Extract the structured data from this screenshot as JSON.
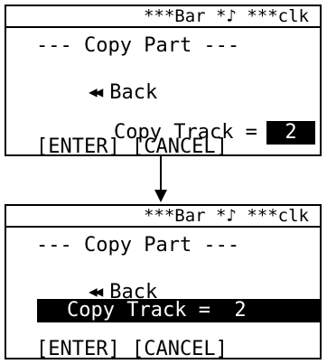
{
  "top_screen": {
    "status": "***Bar *♪ ***clk",
    "title": "--- Copy Part ---",
    "back_label": "Back",
    "copy_label": "Copy Track =",
    "copy_value": "2",
    "keys": "[ENTER] [CANCEL]"
  },
  "bottom_screen": {
    "status": "***Bar *♪ ***clk",
    "title": "--- Copy Part ---",
    "back_label": "Back",
    "copy_row": "Copy Track =  2",
    "keys": "[ENTER] [CANCEL]"
  },
  "icons": {
    "back": "rewind-icon",
    "transition": "down-arrow"
  }
}
